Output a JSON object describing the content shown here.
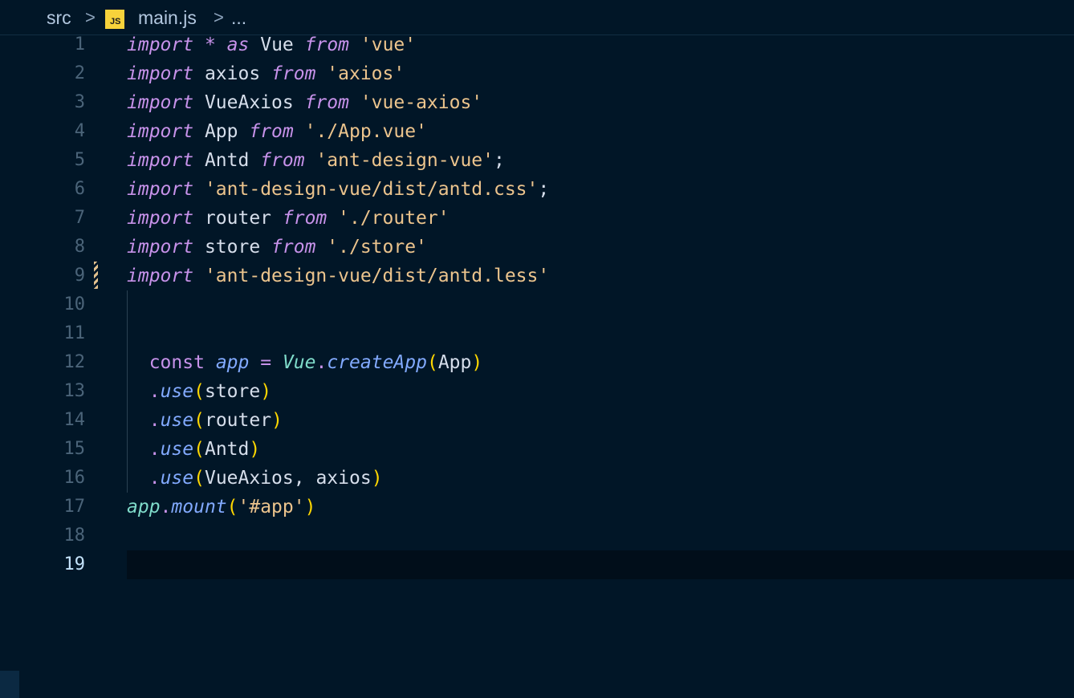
{
  "breadcrumb": {
    "folder": "src",
    "separator": ">",
    "file_icon_label": "JS",
    "file": "main.js",
    "more": "..."
  },
  "editor": {
    "active_line": 19,
    "modified_line": 9,
    "line_numbers": [
      "1",
      "2",
      "3",
      "4",
      "5",
      "6",
      "7",
      "8",
      "9",
      "10",
      "11",
      "12",
      "13",
      "14",
      "15",
      "16",
      "17",
      "18",
      "19"
    ],
    "lines": [
      [
        {
          "t": "kw",
          "v": "import"
        },
        {
          "t": "id",
          "v": " "
        },
        {
          "t": "kw",
          "v": "*"
        },
        {
          "t": "id",
          "v": " "
        },
        {
          "t": "kw",
          "v": "as"
        },
        {
          "t": "id",
          "v": " Vue "
        },
        {
          "t": "kw",
          "v": "from"
        },
        {
          "t": "id",
          "v": " "
        },
        {
          "t": "str",
          "v": "'vue'"
        }
      ],
      [
        {
          "t": "kw",
          "v": "import"
        },
        {
          "t": "id",
          "v": " axios "
        },
        {
          "t": "kw",
          "v": "from"
        },
        {
          "t": "id",
          "v": " "
        },
        {
          "t": "str",
          "v": "'axios'"
        }
      ],
      [
        {
          "t": "kw",
          "v": "import"
        },
        {
          "t": "id",
          "v": " VueAxios "
        },
        {
          "t": "kw",
          "v": "from"
        },
        {
          "t": "id",
          "v": " "
        },
        {
          "t": "str",
          "v": "'vue-axios'"
        }
      ],
      [
        {
          "t": "kw",
          "v": "import"
        },
        {
          "t": "id",
          "v": " App "
        },
        {
          "t": "kw",
          "v": "from"
        },
        {
          "t": "id",
          "v": " "
        },
        {
          "t": "str",
          "v": "'./App.vue'"
        }
      ],
      [
        {
          "t": "kw",
          "v": "import"
        },
        {
          "t": "id",
          "v": " Antd "
        },
        {
          "t": "kw",
          "v": "from"
        },
        {
          "t": "id",
          "v": " "
        },
        {
          "t": "str",
          "v": "'ant-design-vue'"
        },
        {
          "t": "punc",
          "v": ";"
        }
      ],
      [
        {
          "t": "kw",
          "v": "import"
        },
        {
          "t": "id",
          "v": " "
        },
        {
          "t": "str",
          "v": "'ant-design-vue/dist/antd.css'"
        },
        {
          "t": "punc",
          "v": ";"
        }
      ],
      [
        {
          "t": "kw",
          "v": "import"
        },
        {
          "t": "id",
          "v": " router "
        },
        {
          "t": "kw",
          "v": "from"
        },
        {
          "t": "id",
          "v": " "
        },
        {
          "t": "str",
          "v": "'./router'"
        }
      ],
      [
        {
          "t": "kw",
          "v": "import"
        },
        {
          "t": "id",
          "v": " store "
        },
        {
          "t": "kw",
          "v": "from"
        },
        {
          "t": "id",
          "v": " "
        },
        {
          "t": "str",
          "v": "'./store'"
        }
      ],
      [
        {
          "t": "kw",
          "v": "import"
        },
        {
          "t": "id",
          "v": " "
        },
        {
          "t": "str",
          "v": "'ant-design-vue/dist/antd.less'"
        }
      ],
      [],
      [],
      [
        {
          "t": "id",
          "v": "  "
        },
        {
          "t": "kw2",
          "v": "const"
        },
        {
          "t": "id",
          "v": " "
        },
        {
          "t": "var",
          "v": "app"
        },
        {
          "t": "id",
          "v": " "
        },
        {
          "t": "op",
          "v": "="
        },
        {
          "t": "id",
          "v": " "
        },
        {
          "t": "cls",
          "v": "Vue"
        },
        {
          "t": "dot",
          "v": "."
        },
        {
          "t": "fn",
          "v": "createApp"
        },
        {
          "t": "paren",
          "v": "("
        },
        {
          "t": "id",
          "v": "App"
        },
        {
          "t": "paren",
          "v": ")"
        }
      ],
      [
        {
          "t": "id",
          "v": "  "
        },
        {
          "t": "dot",
          "v": "."
        },
        {
          "t": "fn",
          "v": "use"
        },
        {
          "t": "paren",
          "v": "("
        },
        {
          "t": "id",
          "v": "store"
        },
        {
          "t": "paren",
          "v": ")"
        }
      ],
      [
        {
          "t": "id",
          "v": "  "
        },
        {
          "t": "dot",
          "v": "."
        },
        {
          "t": "fn",
          "v": "use"
        },
        {
          "t": "paren",
          "v": "("
        },
        {
          "t": "id",
          "v": "router"
        },
        {
          "t": "paren",
          "v": ")"
        }
      ],
      [
        {
          "t": "id",
          "v": "  "
        },
        {
          "t": "dot",
          "v": "."
        },
        {
          "t": "fn",
          "v": "use"
        },
        {
          "t": "paren",
          "v": "("
        },
        {
          "t": "id",
          "v": "Antd"
        },
        {
          "t": "paren",
          "v": ")"
        }
      ],
      [
        {
          "t": "id",
          "v": "  "
        },
        {
          "t": "dot",
          "v": "."
        },
        {
          "t": "fn",
          "v": "use"
        },
        {
          "t": "paren",
          "v": "("
        },
        {
          "t": "id",
          "v": "VueAxios, axios"
        },
        {
          "t": "paren",
          "v": ")"
        }
      ],
      [
        {
          "t": "cls",
          "v": "app"
        },
        {
          "t": "dot",
          "v": "."
        },
        {
          "t": "fn",
          "v": "mount"
        },
        {
          "t": "paren",
          "v": "("
        },
        {
          "t": "str",
          "v": "'#app'"
        },
        {
          "t": "paren",
          "v": ")"
        }
      ],
      [],
      []
    ]
  },
  "colors": {
    "background": "#011627",
    "keyword": "#c792ea",
    "string": "#ecc48d",
    "identifier": "#d6deeb",
    "function": "#82aaff",
    "class": "#7fdbca",
    "bracket": "#ffd700",
    "line_number": "#4b6479",
    "line_number_active": "#c5e4fd"
  }
}
